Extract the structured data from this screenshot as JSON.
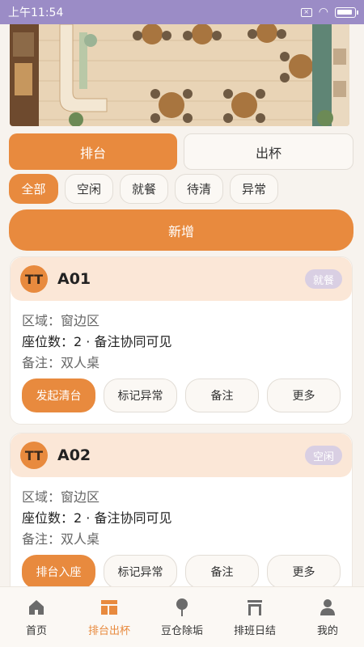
{
  "status_bar": {
    "time": "上午11:54"
  },
  "mode_tabs": [
    {
      "label": "排台",
      "active": true
    },
    {
      "label": "出杯",
      "active": false
    }
  ],
  "filters": [
    {
      "label": "全部",
      "active": true
    },
    {
      "label": "空闲",
      "active": false
    },
    {
      "label": "就餐",
      "active": false
    },
    {
      "label": "待清",
      "active": false
    },
    {
      "label": "异常",
      "active": false
    }
  ],
  "add_button": "新增",
  "tables": [
    {
      "icon": "TT",
      "number": "A01",
      "status": "就餐",
      "area": "区域：窗边区",
      "seats": "座位数：2 · 备注协同可见",
      "note": "备注：双人桌",
      "actions": [
        "发起清台",
        "标记异常",
        "备注",
        "更多"
      ]
    },
    {
      "icon": "TT",
      "number": "A02",
      "status": "空闲",
      "area": "区域：窗边区",
      "seats": "座位数：2 · 备注协同可见",
      "note": "备注：双人桌",
      "actions": [
        "排台入座",
        "标记异常",
        "备注",
        "更多"
      ]
    }
  ],
  "bottom_nav": [
    {
      "label": "首页",
      "icon": "home-icon",
      "active": false
    },
    {
      "label": "排台出杯",
      "icon": "table-layout-icon",
      "active": true
    },
    {
      "label": "豆仓除垢",
      "icon": "pin-icon",
      "active": false
    },
    {
      "label": "排班日结",
      "icon": "calendar-icon",
      "active": false
    },
    {
      "label": "我的",
      "icon": "user-icon",
      "active": false
    }
  ],
  "colors": {
    "accent": "#e88a3e",
    "status_bar": "#9b8cc6",
    "card_head": "#fbe7d7"
  }
}
